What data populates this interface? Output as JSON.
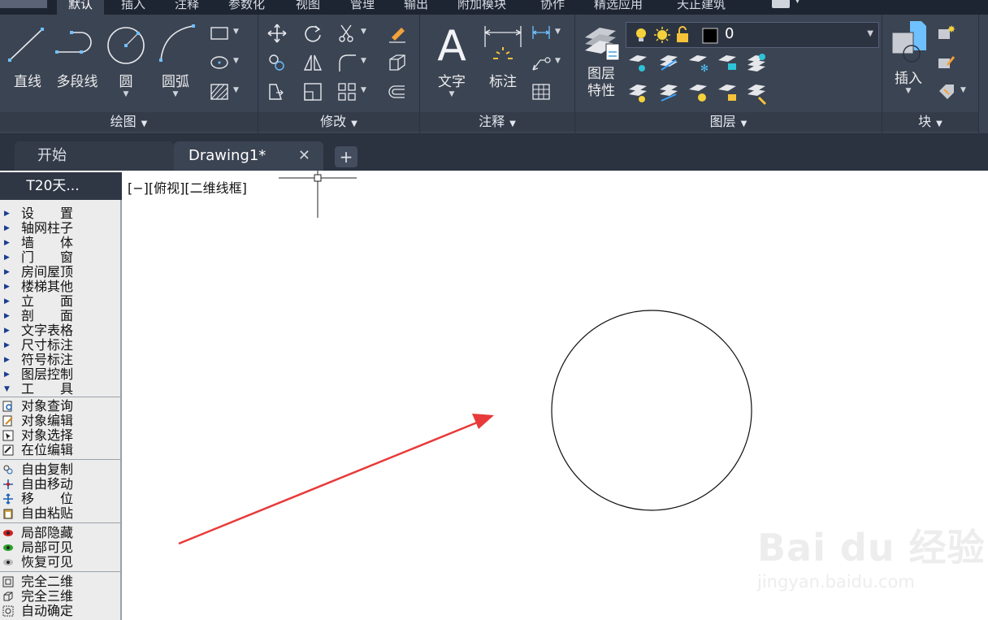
{
  "ribbon": {
    "tabs": [
      "默认",
      "插入",
      "注释",
      "参数化",
      "视图",
      "管理",
      "输出",
      "附加模块",
      "协作",
      "精选应用",
      "天正建筑"
    ],
    "draw_panel": {
      "title": "绘图",
      "line_label": "直线",
      "polyline_label": "多段线",
      "circle_label": "圆",
      "arc_label": "圆弧"
    },
    "modify_panel": {
      "title": "修改"
    },
    "annotation_panel": {
      "title": "注释",
      "text_label": "文字",
      "dimension_label": "标注"
    },
    "layers_panel": {
      "title": "图层",
      "layer_properties_label_line1": "图层",
      "layer_properties_label_line2": "特性",
      "current_layer": "0"
    },
    "block_panel": {
      "title": "块",
      "insert_label": "插入"
    }
  },
  "doc_tabs": {
    "start_label": "开始",
    "drawing_label": "Drawing1*",
    "close_glyph": "✕",
    "add_glyph": "+"
  },
  "side_panel": {
    "title": "T20天...",
    "menu_items": [
      "设　　置",
      "轴网柱子",
      "墙　　体",
      "门　　窗",
      "房间屋顶",
      "楼梯其他",
      "立　　面",
      "剖　　面",
      "文字表格",
      "尺寸标注",
      "符号标注",
      "图层控制",
      "工　　具"
    ],
    "tool_group_1": [
      "对象查询",
      "对象编辑",
      "对象选择",
      "在位编辑"
    ],
    "tool_group_2": [
      "自由复制",
      "自由移动",
      "移　　位",
      "自由粘贴"
    ],
    "tool_group_3": [
      "局部隐藏",
      "局部可见",
      "恢复可见"
    ],
    "tool_group_4": [
      "完全二维",
      "完全三维",
      "自动确定"
    ]
  },
  "canvas": {
    "viewport_label": "[−][俯视][二维线框]",
    "watermark_brand": "Bai du 经验",
    "watermark_url": "jingyan.baidu.com"
  },
  "colors": {
    "ribbon_bg": "#3b4453",
    "tab_bar_bg": "#1e2532",
    "annotation_arrow": "#e83a3a",
    "circle_stroke": "#111111"
  }
}
